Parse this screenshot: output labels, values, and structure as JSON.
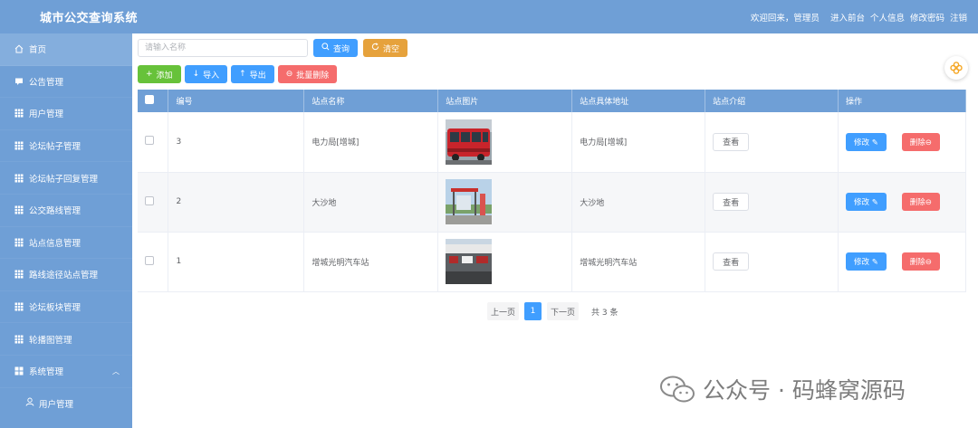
{
  "header": {
    "title": "城市公交查询系统",
    "welcome": "欢迎回来，",
    "role": "管理员",
    "links": [
      "进入前台",
      "个人信息",
      "修改密码",
      "注销"
    ]
  },
  "sidebar": {
    "items": [
      {
        "label": "首页",
        "icon": "home-icon"
      },
      {
        "label": "公告管理",
        "icon": "message-icon"
      },
      {
        "label": "用户管理",
        "icon": "grid-icon"
      },
      {
        "label": "论坛帖子管理",
        "icon": "grid-icon"
      },
      {
        "label": "论坛帖子回复管理",
        "icon": "grid-icon"
      },
      {
        "label": "公交路线管理",
        "icon": "grid-icon"
      },
      {
        "label": "站点信息管理",
        "icon": "grid-icon"
      },
      {
        "label": "路线途径站点管理",
        "icon": "grid-icon"
      },
      {
        "label": "论坛板块管理",
        "icon": "grid-icon"
      },
      {
        "label": "轮播图管理",
        "icon": "grid-icon"
      },
      {
        "label": "系统管理",
        "icon": "apps-icon"
      }
    ],
    "sub_item": {
      "label": "用户管理",
      "icon": "user-icon"
    }
  },
  "search": {
    "placeholder": "请输入名称",
    "search_label": "查询",
    "clear_label": "清空"
  },
  "actions": {
    "add": "添加",
    "import": "导入",
    "export": "导出",
    "batch_delete": "批量删除"
  },
  "table": {
    "columns": [
      "编号",
      "站点名称",
      "站点图片",
      "站点具体地址",
      "站点介绍",
      "操作"
    ],
    "view_label": "查看",
    "edit_label": "修改",
    "delete_label": "删除",
    "rows": [
      {
        "id": "3",
        "name": "电力局[增城]",
        "address": "电力局[增城]"
      },
      {
        "id": "2",
        "name": "大沙地",
        "address": "大沙地"
      },
      {
        "id": "1",
        "name": "增城光明汽车站",
        "address": "增城光明汽车站"
      }
    ]
  },
  "pagination": {
    "prev": "上一页",
    "current": "1",
    "next": "下一页",
    "total": "共 3 条"
  },
  "watermark": {
    "text": "公众号 · 码蜂窝源码"
  },
  "colors": {
    "header_bg": "#6f9fd6",
    "primary": "#409eff",
    "success": "#67c23a",
    "warning": "#e6a23c",
    "danger": "#f56c6c"
  }
}
